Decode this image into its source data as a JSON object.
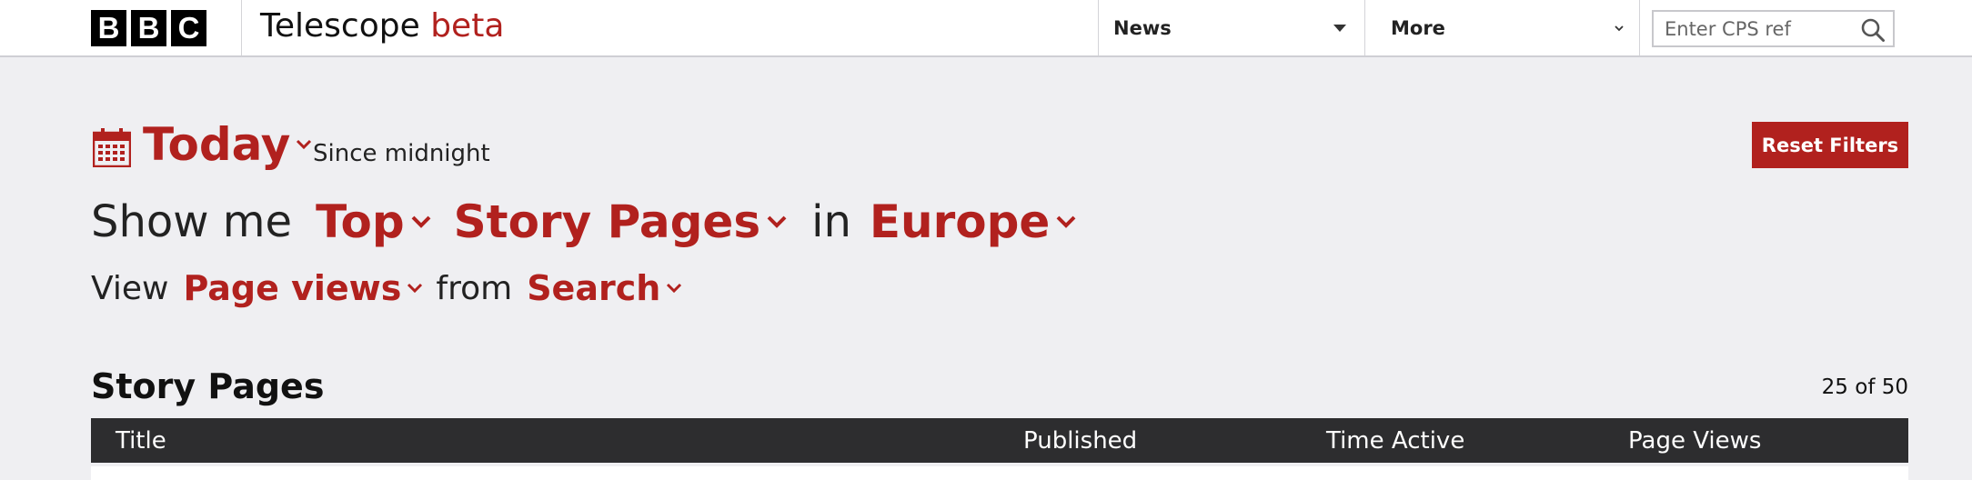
{
  "header": {
    "logo_letters": [
      "B",
      "B",
      "C"
    ],
    "app_name": "Telescope",
    "app_badge": "beta",
    "nav": [
      {
        "label": "News",
        "icon": "triangle-down-icon"
      },
      {
        "label": "More",
        "icon": "chevron-down-icon"
      }
    ],
    "search": {
      "placeholder": "Enter CPS ref",
      "value": "",
      "icon": "search-icon"
    }
  },
  "filters": {
    "period": {
      "label": "Today",
      "note": "Since midnight",
      "icon": "calendar-icon"
    },
    "show_prefix": "Show me",
    "rank": "Top",
    "content_type": "Story Pages",
    "in_label": "in",
    "region": "Europe",
    "view_label": "View",
    "metric": "Page views",
    "from_label": "from",
    "source": "Search",
    "reset_label": "Reset Filters"
  },
  "table": {
    "title": "Story Pages",
    "count_text": "25 of 50",
    "columns": [
      "Title",
      "Published",
      "Time Active",
      "Page Views"
    ]
  },
  "colors": {
    "accent": "#b1211e",
    "background": "#efeff2",
    "table_header": "#2d2d2f",
    "header_bg": "#ffffff"
  }
}
